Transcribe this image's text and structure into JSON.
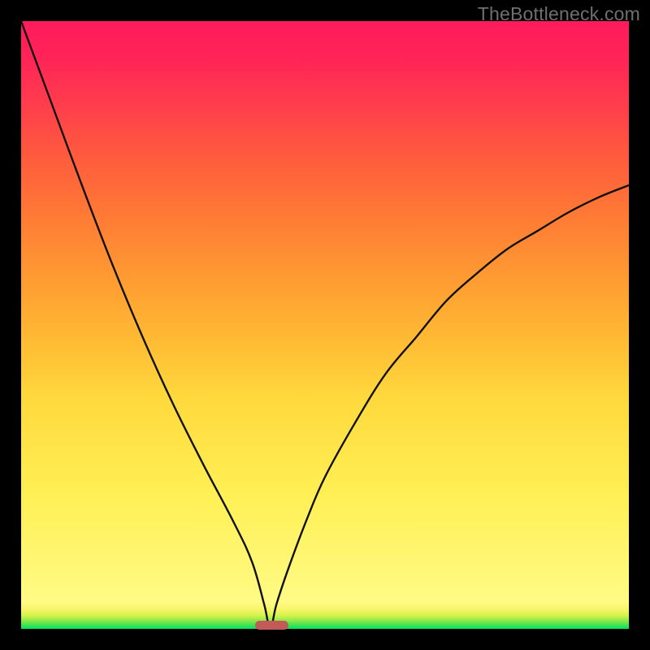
{
  "watermark": "TheBottleneck.com",
  "colors": {
    "page_bg": "#000000",
    "watermark": "#6f6f6f",
    "pill": "#c35a5a",
    "curve": "#111111",
    "gradient_top": "#ff1b5c",
    "gradient_bottom": "#00e060"
  },
  "chart_data": {
    "type": "line",
    "title": "",
    "xlabel": "",
    "ylabel": "",
    "xlim": [
      0,
      100
    ],
    "ylim": [
      0,
      100
    ],
    "grid": false,
    "legend": false,
    "description": "Bottleneck curve: value drops from ~100 at x≈0 to 0 at the sweet-spot x≈41, then rises toward ~73 at x=100. Background gradient encodes severity (red high → green low).",
    "optimum_x": 41,
    "series": [
      {
        "name": "bottleneck",
        "x": [
          0,
          5,
          10,
          15,
          20,
          25,
          30,
          35,
          38,
          40,
          41,
          42,
          44,
          47,
          50,
          55,
          60,
          65,
          70,
          75,
          80,
          85,
          90,
          95,
          100
        ],
        "values": [
          100,
          86.5,
          73,
          60,
          48,
          37,
          27,
          17.5,
          11,
          4,
          0,
          4,
          10,
          18,
          25,
          34,
          42,
          48,
          54,
          58.5,
          62.5,
          65.5,
          68.5,
          71,
          73
        ]
      }
    ],
    "optimum_marker": {
      "x_start": 38.5,
      "x_end": 44,
      "y": 0.5,
      "label": ""
    }
  }
}
